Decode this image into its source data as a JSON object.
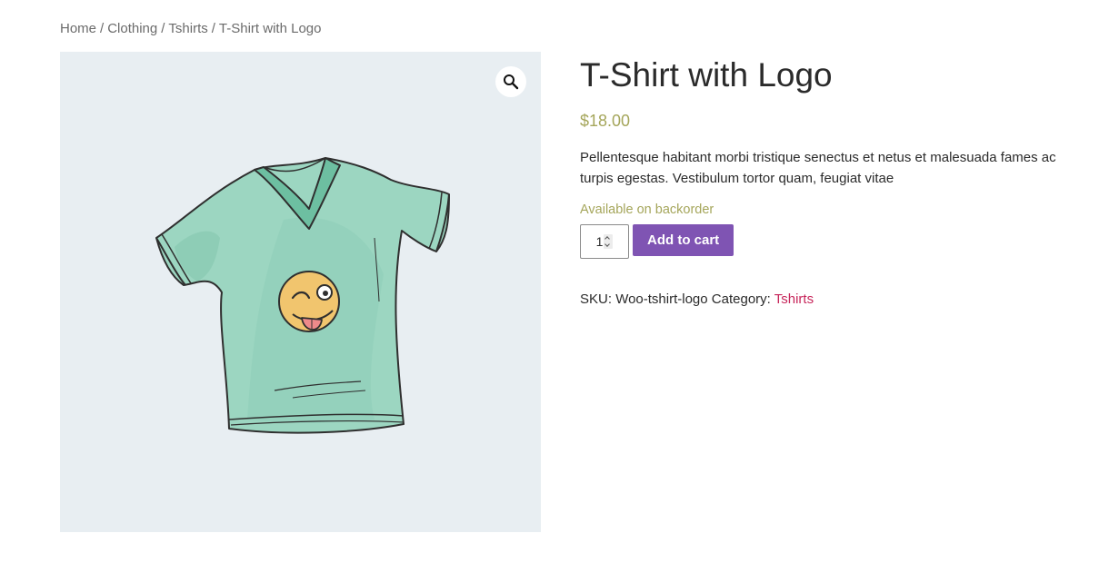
{
  "breadcrumb": {
    "items": [
      "Home",
      "Clothing",
      "Tshirts"
    ],
    "current": "T-Shirt with Logo",
    "separator": "/"
  },
  "gallery": {
    "zoom_icon": "magnifier-icon",
    "image_subject": "tshirt-with-winking-emoji-logo"
  },
  "product": {
    "title": "T-Shirt with Logo",
    "price": "$18.00",
    "description": "Pellentesque habitant morbi tristique senectus et netus et malesuada fames ac turpis egestas. Vestibulum tortor quam, feugiat vitae",
    "stock": "Available on backorder",
    "quantity": "1",
    "add_to_cart_label": "Add to cart",
    "sku_label": "SKU:",
    "sku_value": "Woo-tshirt-logo",
    "category_label": "Category:",
    "category_value": "Tshirts"
  },
  "colors": {
    "price": "#a5a65b",
    "button": "#7f54b3",
    "category_link": "#c7265b",
    "gallery_bg": "#e8eef2"
  }
}
